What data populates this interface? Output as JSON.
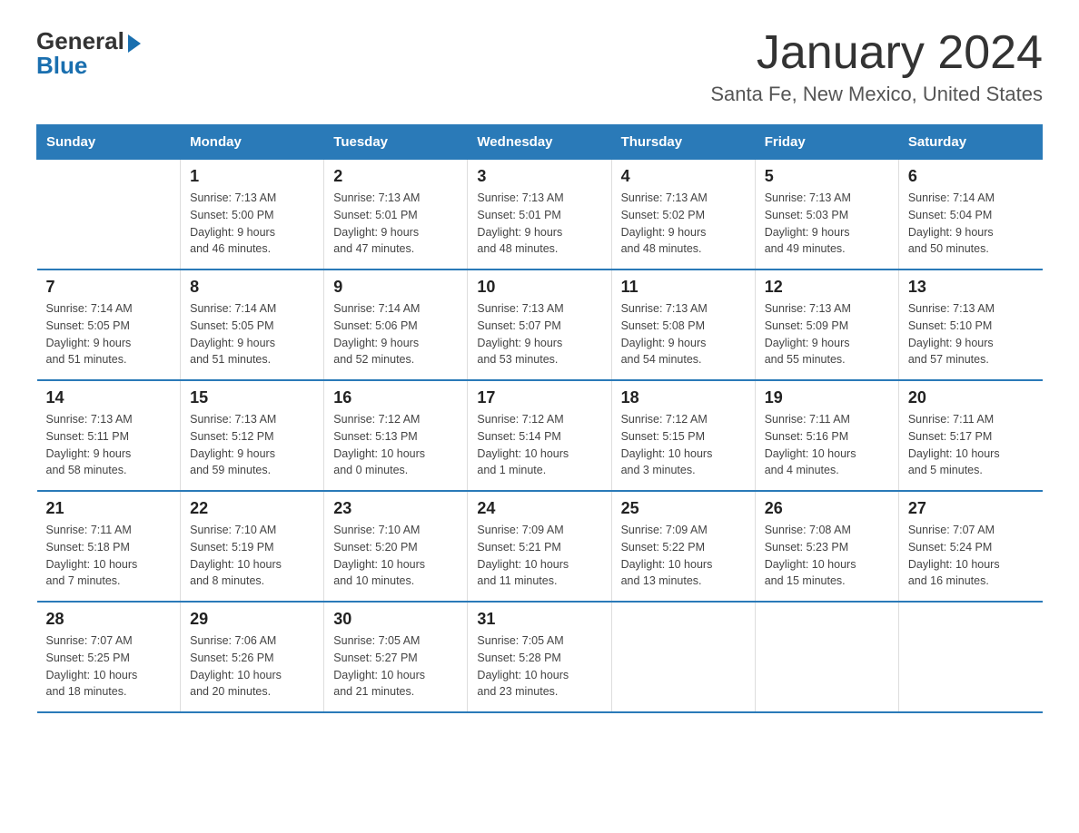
{
  "header": {
    "logo_general": "General",
    "logo_blue": "Blue",
    "title": "January 2024",
    "subtitle": "Santa Fe, New Mexico, United States"
  },
  "columns": [
    "Sunday",
    "Monday",
    "Tuesday",
    "Wednesday",
    "Thursday",
    "Friday",
    "Saturday"
  ],
  "weeks": [
    [
      {
        "day": "",
        "info": ""
      },
      {
        "day": "1",
        "info": "Sunrise: 7:13 AM\nSunset: 5:00 PM\nDaylight: 9 hours\nand 46 minutes."
      },
      {
        "day": "2",
        "info": "Sunrise: 7:13 AM\nSunset: 5:01 PM\nDaylight: 9 hours\nand 47 minutes."
      },
      {
        "day": "3",
        "info": "Sunrise: 7:13 AM\nSunset: 5:01 PM\nDaylight: 9 hours\nand 48 minutes."
      },
      {
        "day": "4",
        "info": "Sunrise: 7:13 AM\nSunset: 5:02 PM\nDaylight: 9 hours\nand 48 minutes."
      },
      {
        "day": "5",
        "info": "Sunrise: 7:13 AM\nSunset: 5:03 PM\nDaylight: 9 hours\nand 49 minutes."
      },
      {
        "day": "6",
        "info": "Sunrise: 7:14 AM\nSunset: 5:04 PM\nDaylight: 9 hours\nand 50 minutes."
      }
    ],
    [
      {
        "day": "7",
        "info": "Sunrise: 7:14 AM\nSunset: 5:05 PM\nDaylight: 9 hours\nand 51 minutes."
      },
      {
        "day": "8",
        "info": "Sunrise: 7:14 AM\nSunset: 5:05 PM\nDaylight: 9 hours\nand 51 minutes."
      },
      {
        "day": "9",
        "info": "Sunrise: 7:14 AM\nSunset: 5:06 PM\nDaylight: 9 hours\nand 52 minutes."
      },
      {
        "day": "10",
        "info": "Sunrise: 7:13 AM\nSunset: 5:07 PM\nDaylight: 9 hours\nand 53 minutes."
      },
      {
        "day": "11",
        "info": "Sunrise: 7:13 AM\nSunset: 5:08 PM\nDaylight: 9 hours\nand 54 minutes."
      },
      {
        "day": "12",
        "info": "Sunrise: 7:13 AM\nSunset: 5:09 PM\nDaylight: 9 hours\nand 55 minutes."
      },
      {
        "day": "13",
        "info": "Sunrise: 7:13 AM\nSunset: 5:10 PM\nDaylight: 9 hours\nand 57 minutes."
      }
    ],
    [
      {
        "day": "14",
        "info": "Sunrise: 7:13 AM\nSunset: 5:11 PM\nDaylight: 9 hours\nand 58 minutes."
      },
      {
        "day": "15",
        "info": "Sunrise: 7:13 AM\nSunset: 5:12 PM\nDaylight: 9 hours\nand 59 minutes."
      },
      {
        "day": "16",
        "info": "Sunrise: 7:12 AM\nSunset: 5:13 PM\nDaylight: 10 hours\nand 0 minutes."
      },
      {
        "day": "17",
        "info": "Sunrise: 7:12 AM\nSunset: 5:14 PM\nDaylight: 10 hours\nand 1 minute."
      },
      {
        "day": "18",
        "info": "Sunrise: 7:12 AM\nSunset: 5:15 PM\nDaylight: 10 hours\nand 3 minutes."
      },
      {
        "day": "19",
        "info": "Sunrise: 7:11 AM\nSunset: 5:16 PM\nDaylight: 10 hours\nand 4 minutes."
      },
      {
        "day": "20",
        "info": "Sunrise: 7:11 AM\nSunset: 5:17 PM\nDaylight: 10 hours\nand 5 minutes."
      }
    ],
    [
      {
        "day": "21",
        "info": "Sunrise: 7:11 AM\nSunset: 5:18 PM\nDaylight: 10 hours\nand 7 minutes."
      },
      {
        "day": "22",
        "info": "Sunrise: 7:10 AM\nSunset: 5:19 PM\nDaylight: 10 hours\nand 8 minutes."
      },
      {
        "day": "23",
        "info": "Sunrise: 7:10 AM\nSunset: 5:20 PM\nDaylight: 10 hours\nand 10 minutes."
      },
      {
        "day": "24",
        "info": "Sunrise: 7:09 AM\nSunset: 5:21 PM\nDaylight: 10 hours\nand 11 minutes."
      },
      {
        "day": "25",
        "info": "Sunrise: 7:09 AM\nSunset: 5:22 PM\nDaylight: 10 hours\nand 13 minutes."
      },
      {
        "day": "26",
        "info": "Sunrise: 7:08 AM\nSunset: 5:23 PM\nDaylight: 10 hours\nand 15 minutes."
      },
      {
        "day": "27",
        "info": "Sunrise: 7:07 AM\nSunset: 5:24 PM\nDaylight: 10 hours\nand 16 minutes."
      }
    ],
    [
      {
        "day": "28",
        "info": "Sunrise: 7:07 AM\nSunset: 5:25 PM\nDaylight: 10 hours\nand 18 minutes."
      },
      {
        "day": "29",
        "info": "Sunrise: 7:06 AM\nSunset: 5:26 PM\nDaylight: 10 hours\nand 20 minutes."
      },
      {
        "day": "30",
        "info": "Sunrise: 7:05 AM\nSunset: 5:27 PM\nDaylight: 10 hours\nand 21 minutes."
      },
      {
        "day": "31",
        "info": "Sunrise: 7:05 AM\nSunset: 5:28 PM\nDaylight: 10 hours\nand 23 minutes."
      },
      {
        "day": "",
        "info": ""
      },
      {
        "day": "",
        "info": ""
      },
      {
        "day": "",
        "info": ""
      }
    ]
  ]
}
